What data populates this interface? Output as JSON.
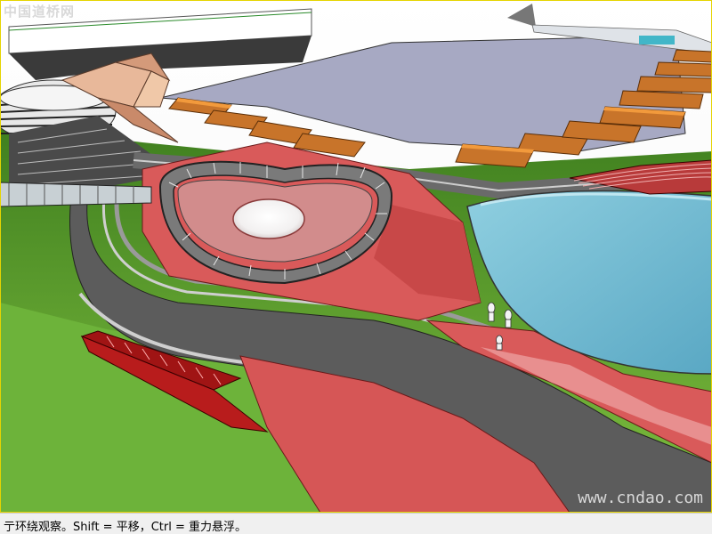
{
  "app": {
    "watermark_left": "中国道桥网",
    "watermark_right": "www.cndao.com"
  },
  "statusbar": {
    "hint_text": "亍环绕观察。Shift = 平移，Ctrl = 重力悬浮。"
  },
  "colors": {
    "accent_frame": "#e5d400",
    "plaza_red": "#d95a5a",
    "plaza_pink": "#e88f8f",
    "water": "#6bb8d0",
    "grass": "#5a9e2e",
    "road": "#5c5c5c",
    "roof": "#a7a9c3"
  },
  "icons": [
    "pedestrian-figure-icon"
  ]
}
